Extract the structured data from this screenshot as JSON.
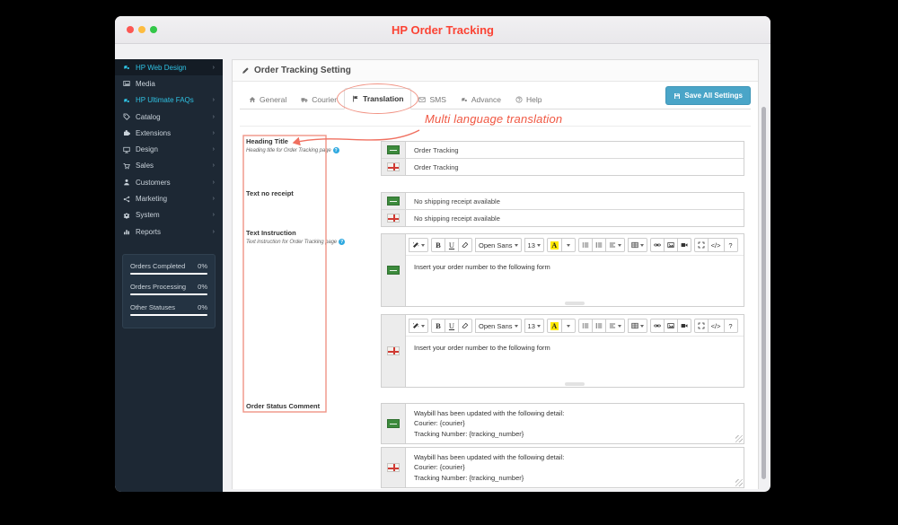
{
  "window": {
    "title": "HP Order Tracking"
  },
  "sidebar": {
    "items": [
      {
        "label": "HP Web Design"
      },
      {
        "label": "Media"
      },
      {
        "label": "HP Ultimate FAQs"
      },
      {
        "label": "Catalog"
      },
      {
        "label": "Extensions"
      },
      {
        "label": "Design"
      },
      {
        "label": "Sales"
      },
      {
        "label": "Customers"
      },
      {
        "label": "Marketing"
      },
      {
        "label": "System"
      },
      {
        "label": "Reports"
      }
    ],
    "stats": [
      {
        "label": "Orders Completed",
        "value": "0%"
      },
      {
        "label": "Orders Processing",
        "value": "0%"
      },
      {
        "label": "Other Statuses",
        "value": "0%"
      }
    ]
  },
  "panel": {
    "heading": "Order Tracking Setting",
    "save_button": "Save All Settings",
    "annotation": "Multi language translation",
    "tabs": [
      {
        "label": "General"
      },
      {
        "label": "Courier"
      },
      {
        "label": "Translation"
      },
      {
        "label": "SMS"
      },
      {
        "label": "Advance"
      },
      {
        "label": "Help"
      }
    ]
  },
  "form": {
    "heading_title": {
      "label": "Heading Title",
      "help": "Heading title for Order Tracking page",
      "value_en": "Order Tracking",
      "value_alt": "Order Tracking"
    },
    "text_no_receipt": {
      "label": "Text no receipt",
      "value_en": "No shipping receipt available",
      "value_alt": "No shipping receipt available"
    },
    "text_instruction": {
      "label": "Text Instruction",
      "help": "Text instruction for Order Tracking page",
      "value_en": "Insert your order number to the following form",
      "value_alt": "Insert your order number to the following form"
    },
    "order_status_comment": {
      "label": "Order Status Comment",
      "value_en": "Waybill has been updated with the following detail:\nCourier: {courier}\nTracking Number: {tracking_number}",
      "value_alt": "Waybill has been updated with the following detail:\nCourier: {courier}\nTracking Number: {tracking_number}"
    }
  },
  "editor": {
    "bold": "B",
    "underline": "U",
    "font": "Open Sans",
    "size": "13",
    "color": "A",
    "code": "</>",
    "help": "?"
  }
}
